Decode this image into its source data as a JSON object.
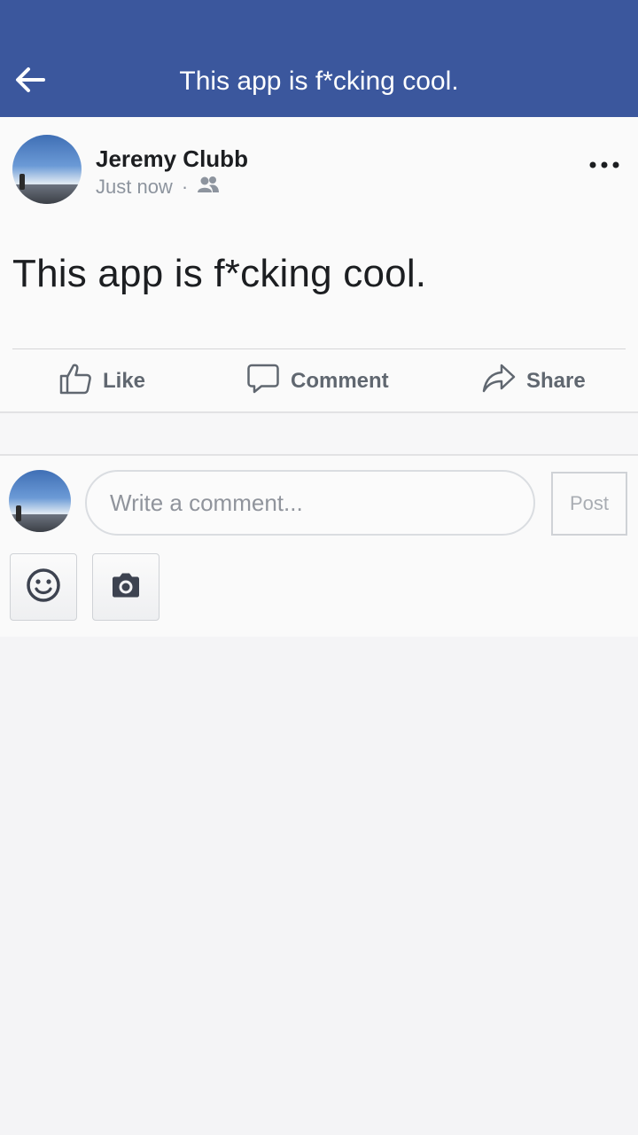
{
  "header": {
    "title": "This app is f*cking cool.",
    "back_icon": "arrow-left-icon"
  },
  "post": {
    "author": "Jeremy Clubb",
    "timestamp": "Just now",
    "separator": "·",
    "audience_icon": "friends-icon",
    "more_icon": "more-horizontal-icon",
    "text": "This app is f*cking cool.",
    "actions": {
      "like_label": "Like",
      "comment_label": "Comment",
      "share_label": "Share"
    }
  },
  "composer": {
    "placeholder": "Write a comment...",
    "post_label": "Post",
    "tools": [
      "emoji-icon",
      "camera-icon"
    ]
  },
  "colors": {
    "header_bg": "#3b579d",
    "page_bg": "#f4f4f6",
    "action_text": "#606770"
  }
}
